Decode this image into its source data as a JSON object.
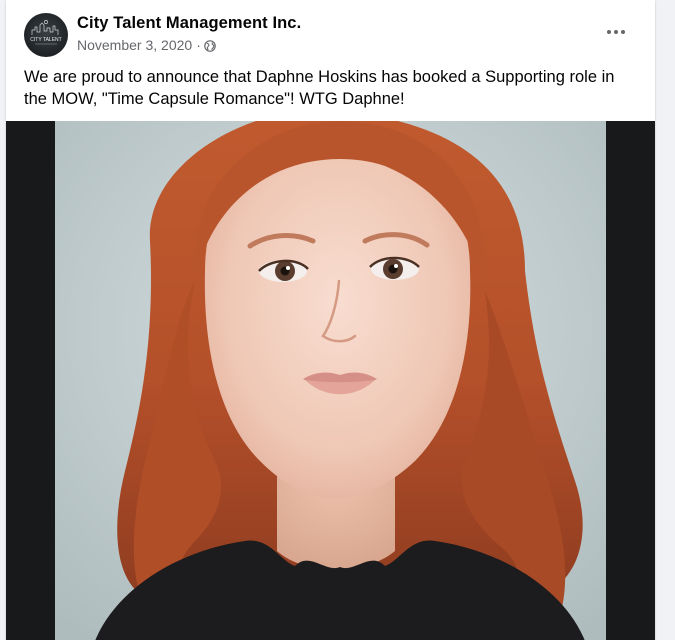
{
  "post": {
    "author_name": "City Talent Management Inc.",
    "date": "November 3, 2020",
    "separator": "·",
    "privacy_icon": "globe-icon",
    "more_icon": "more-options-icon",
    "text": "We are proud to announce that Daphne Hoskins has booked a Supporting role in the MOW, \"Time Capsule Romance\"! WTG Daphne!",
    "avatar": {
      "label": "CITY TALENT",
      "icon": "city-skyline-logo"
    },
    "photo": {
      "subject": "headshot-photo"
    }
  },
  "colors": {
    "page_background": "#f0f2f5",
    "card_background": "#ffffff",
    "primary_text": "#050505",
    "secondary_text": "#65676b",
    "media_letterbox": "#18191a"
  }
}
